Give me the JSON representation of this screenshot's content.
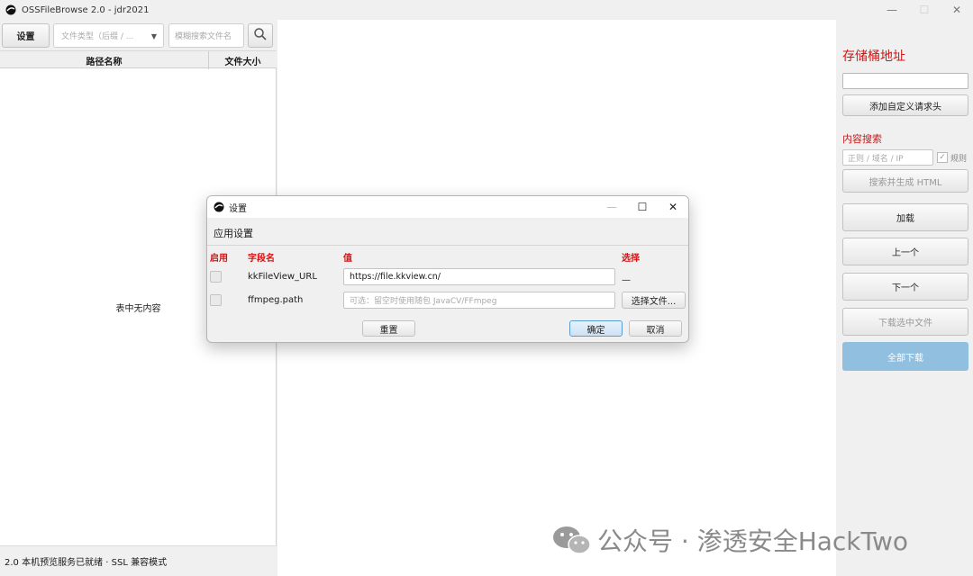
{
  "window": {
    "title": "OSSFileBrowse 2.0 - jdr2021",
    "controls": [
      "—",
      "☐",
      "✕"
    ]
  },
  "toolbar": {
    "settings_label": "设置",
    "type_filter_placeholder": "文件类型（后缀 / ...",
    "name_search_placeholder": "模糊搜索文件名"
  },
  "file_table": {
    "columns": [
      "路径名称",
      "文件大小"
    ],
    "empty_text": "表中无内容"
  },
  "status": {
    "text": "2.0 本机预览服务已就绪 · SSL 兼容模式"
  },
  "right_panel": {
    "bucket_title": "存储桶地址",
    "add_header_label": "添加自定义请求头",
    "content_search_title": "内容搜索",
    "regex_placeholder": "正则 / 域名 / IP",
    "regex_checked": true,
    "regex_label": "规则",
    "search_html_label": "搜索并生成 HTML",
    "load_label": "加载",
    "prev_label": "上一个",
    "next_label": "下一个",
    "download_selected_label": "下载选中文件",
    "download_all_label": "全部下载",
    "accent_color": "#d21414"
  },
  "dialog": {
    "title": "设置",
    "section": "应用设置",
    "columns": {
      "enable": "启用",
      "field": "字段名",
      "value": "值",
      "choose": "选择"
    },
    "rows": [
      {
        "enabled": false,
        "field": "kkFileView_URL",
        "value": "https://file.kkview.cn/",
        "choose": "—"
      },
      {
        "enabled": false,
        "field": "ffmpeg.path",
        "placeholder": "可选：留空时使用随包 JavaCV/FFmpeg",
        "choose": "选择文件..."
      }
    ],
    "reset_label": "重置",
    "ok_label": "确定",
    "cancel_label": "取消"
  },
  "watermark": {
    "text": "公众号 · 渗透安全HackTwo"
  }
}
